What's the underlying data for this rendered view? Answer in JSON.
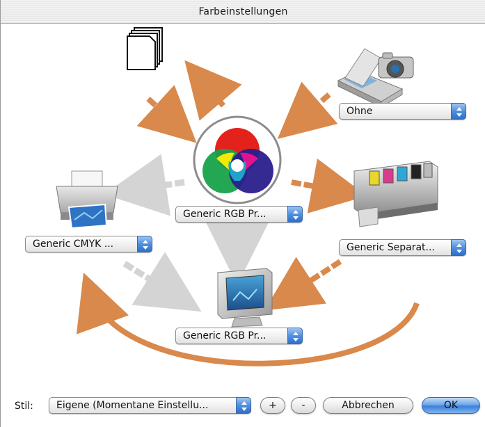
{
  "window": {
    "title": "Farbeinstellungen"
  },
  "popups": {
    "input_profile": "Ohne",
    "rgb_profile": "Generic RGB Pr...",
    "cmyk_profile": "Generic CMYK ...",
    "separation_profile": "Generic Separat...",
    "monitor_profile": "Generic RGB Pr..."
  },
  "bottom": {
    "stil_label": "Stil:",
    "stil_value": "Eigene (Momentane Einstellu...",
    "plus_label": "+",
    "minus_label": "-",
    "cancel_label": "Abbrechen",
    "ok_label": "OK"
  },
  "colors": {
    "arrow_orange": "#d9894b",
    "arrow_gray": "#d4d4d4",
    "accent_blue": "#3d7fd9"
  },
  "icons": {
    "documents": "documents-icon",
    "scanner_camera": "scanner-camera-icon",
    "rgb_wheel": "rgb-color-wheel-icon",
    "printer": "printer-icon",
    "press": "printing-press-icon",
    "monitor": "monitor-icon"
  }
}
